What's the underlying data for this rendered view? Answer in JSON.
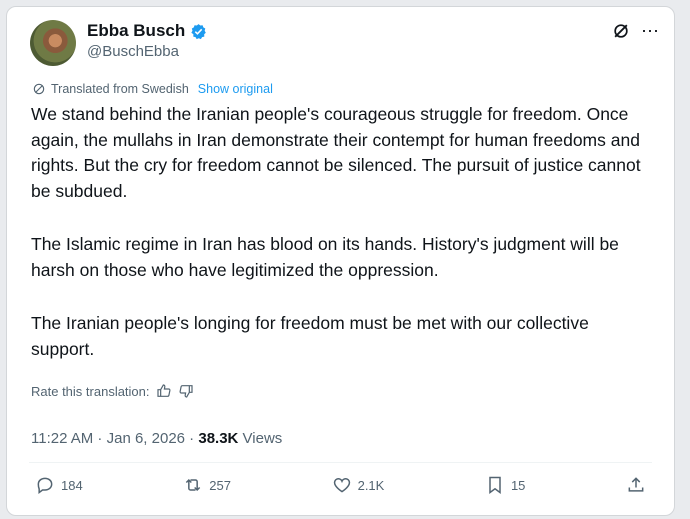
{
  "author": {
    "name": "Ebba Busch",
    "handle": "@BuschEbba"
  },
  "translation": {
    "label": "Translated from Swedish",
    "show_original": "Show original",
    "rate_label": "Rate this translation:"
  },
  "post": {
    "paragraphs": [
      "We stand behind the Iranian people's courageous struggle for freedom. Once again, the mullahs in Iran demonstrate their contempt for human freedoms and rights. But the cry for freedom cannot be silenced. The pursuit of justice cannot be subdued.",
      "The Islamic regime in Iran has blood on its hands. History's judgment will be harsh on those who have legitimized the oppression.",
      "The Iranian people's longing for freedom must be met with our collective support."
    ]
  },
  "meta": {
    "time": "11:22 AM",
    "sep1": " · ",
    "date": "Jan 6, 2026",
    "sep2": " · ",
    "views_count": "38.3K",
    "views_label": " Views"
  },
  "stats": {
    "replies": "184",
    "reposts": "257",
    "likes": "2.1K",
    "bookmarks": "15"
  },
  "icons": {
    "verified": "verified-badge-icon",
    "grok": "grok-icon",
    "more": "more-icon",
    "translate": "translate-icon",
    "reply": "reply-icon",
    "repost": "repost-icon",
    "like": "heart-icon",
    "bookmark": "bookmark-icon",
    "share": "share-icon"
  },
  "colors": {
    "accent": "#1d9bf0",
    "text": "#0f1419",
    "secondary": "#536471"
  }
}
